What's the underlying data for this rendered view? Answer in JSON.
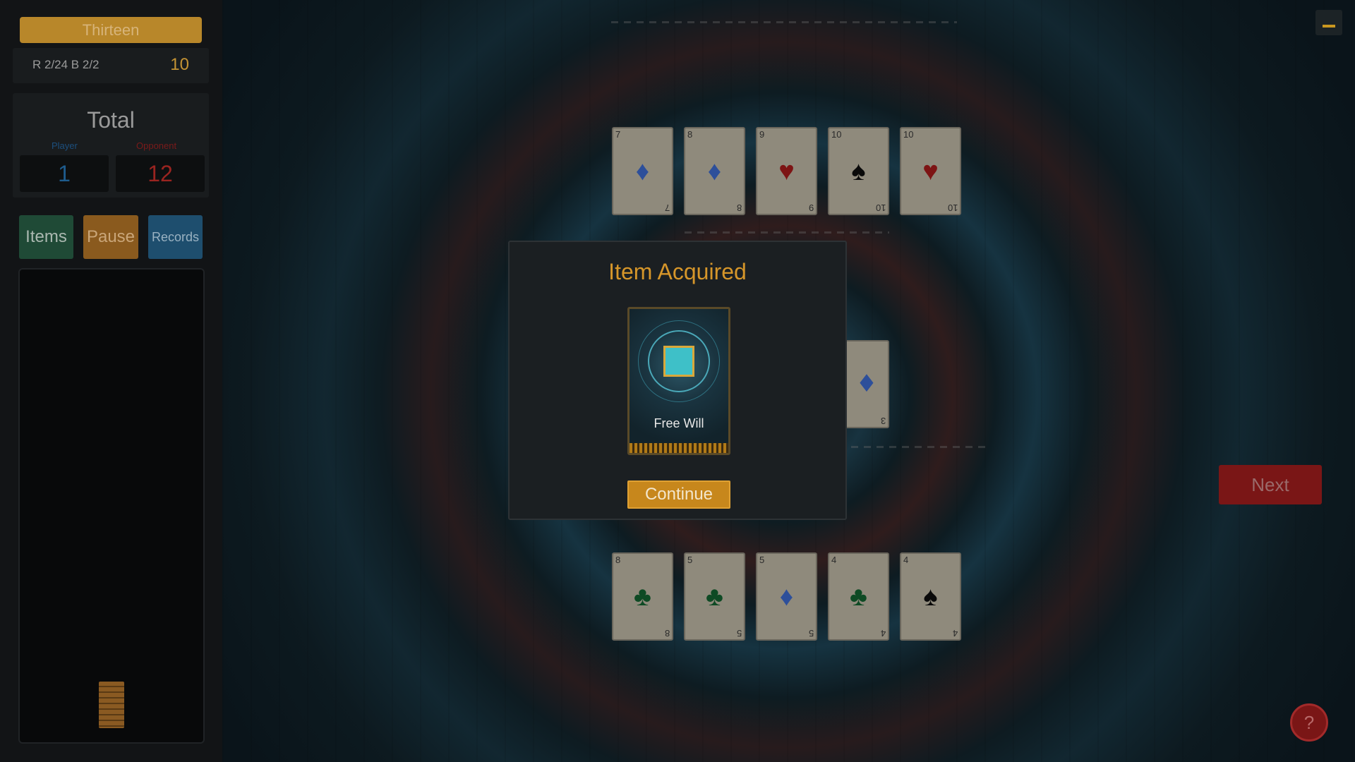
{
  "header": {
    "game_title": "Thirteen",
    "round_info": "R 2/24  B 2/2",
    "target_value": "10"
  },
  "totals": {
    "title": "Total",
    "player_label": "Player",
    "opponent_label": "Opponent",
    "player_score": "1",
    "opponent_score": "12"
  },
  "buttons": {
    "items": "Items",
    "pause": "Pause",
    "records": "Records",
    "next": "Next",
    "help": "?"
  },
  "opponent_cards": [
    {
      "rank": "7",
      "suit": "diamond",
      "glyph": "♦"
    },
    {
      "rank": "8",
      "suit": "diamond",
      "glyph": "♦"
    },
    {
      "rank": "9",
      "suit": "heart",
      "glyph": "♥"
    },
    {
      "rank": "10",
      "suit": "spade",
      "glyph": "♠"
    },
    {
      "rank": "10",
      "suit": "heart",
      "glyph": "♥"
    }
  ],
  "player_cards": [
    {
      "rank": "8",
      "suit": "club",
      "glyph": "♣"
    },
    {
      "rank": "5",
      "suit": "club",
      "glyph": "♣"
    },
    {
      "rank": "5",
      "suit": "diamond",
      "glyph": "♦"
    },
    {
      "rank": "4",
      "suit": "club",
      "glyph": "♣"
    },
    {
      "rank": "4",
      "suit": "spade",
      "glyph": "♠"
    }
  ],
  "table_card": {
    "rank": "3",
    "suit": "diamond",
    "glyph": "♦"
  },
  "modal": {
    "title": "Item Acquired",
    "item_name": "Free Will",
    "continue_label": "Continue"
  },
  "colors": {
    "accent_gold": "#c7871c",
    "player_blue": "#1e5c8e",
    "opponent_red": "#9a2420"
  }
}
